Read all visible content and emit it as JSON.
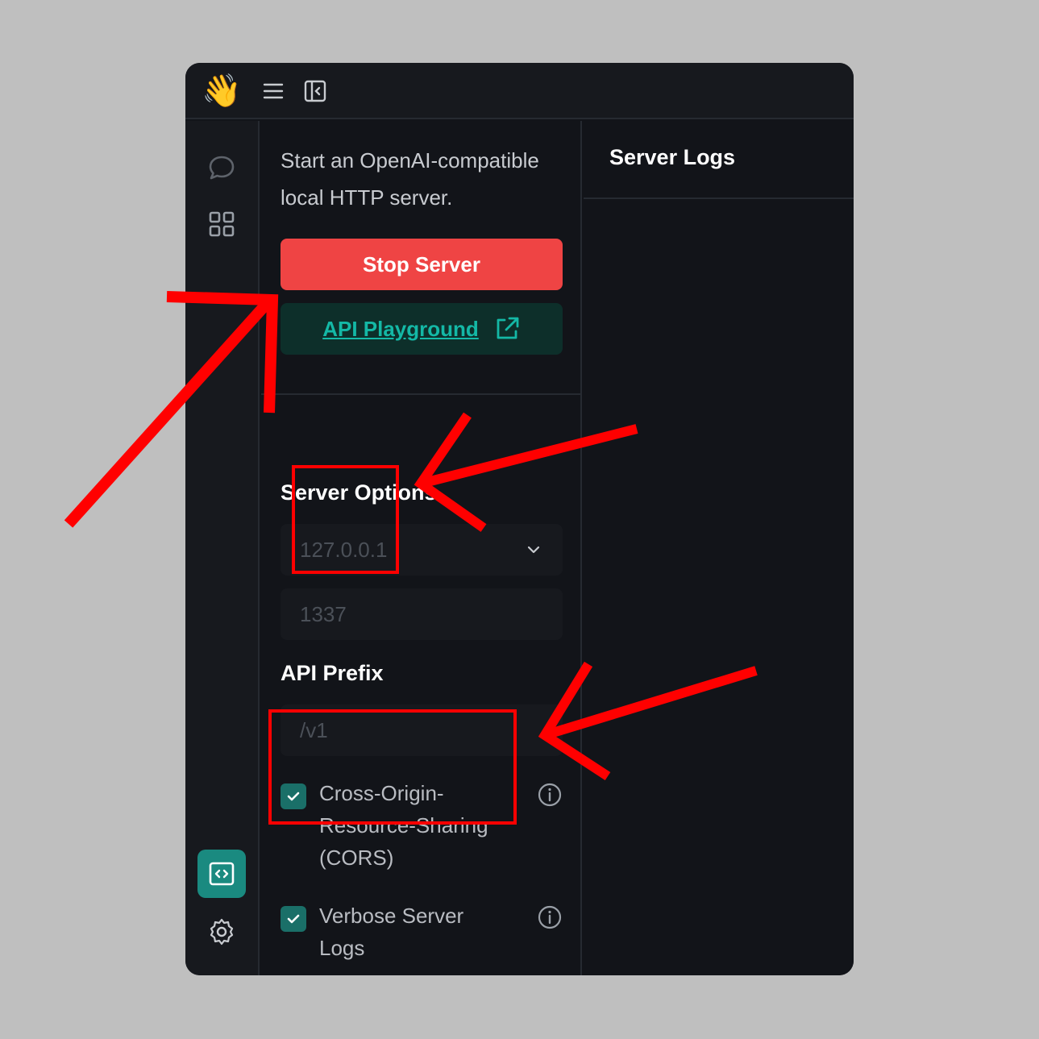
{
  "sidebar": {
    "icons": [
      "chat-icon",
      "grid-icon",
      "code-icon",
      "gear-icon"
    ]
  },
  "panel": {
    "description": "Start an OpenAI-compatible local HTTP server.",
    "stop_button": "Stop Server",
    "playground_link": "API Playground",
    "server_options_title": "Server Options",
    "host_value": "127.0.0.1",
    "port_value": "1337",
    "api_prefix_title": "API Prefix",
    "api_prefix_value": "/v1",
    "cors_label": "Cross-Origin-Resource-Sharing (CORS)",
    "cors_checked": true,
    "verbose_label": "Verbose Server Logs",
    "verbose_checked": true
  },
  "logs": {
    "title": "Server Logs"
  },
  "colors": {
    "accent": "#14b8a6",
    "danger": "#ef4444",
    "annotation": "#ff0000"
  }
}
